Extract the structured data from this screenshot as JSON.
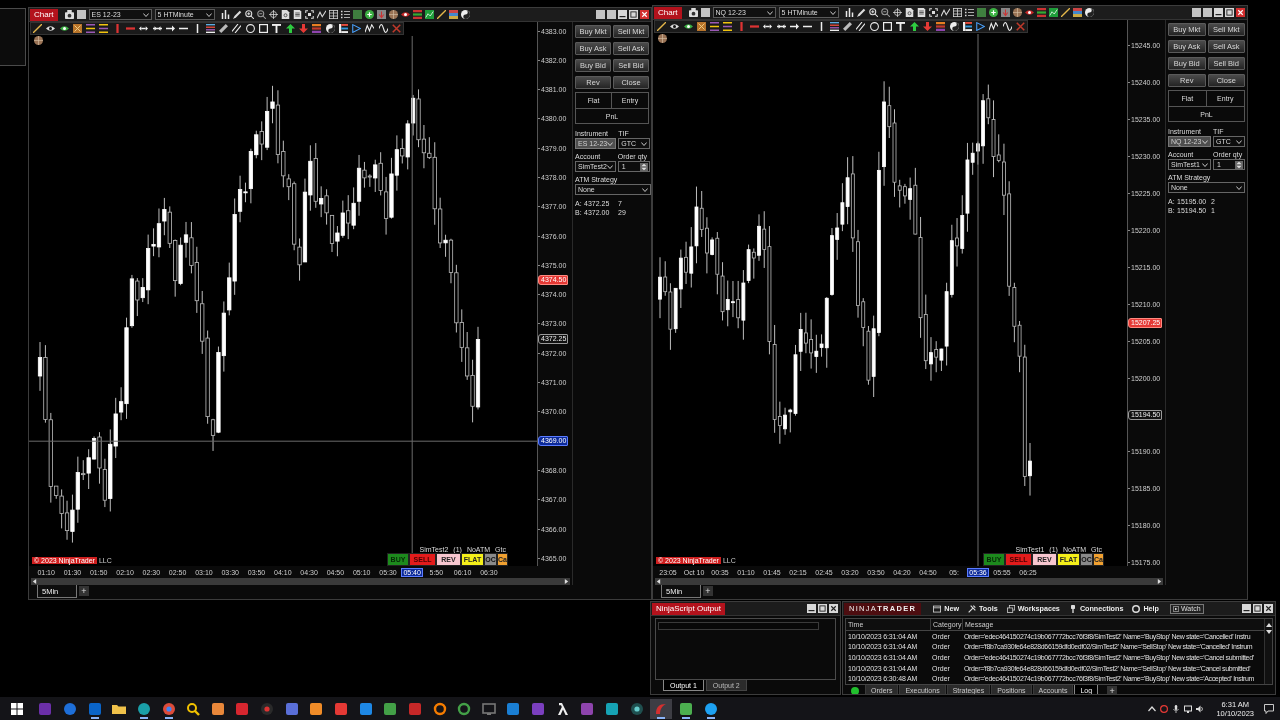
{
  "charts": [
    {
      "title": "Chart",
      "instrument": "ES 12-23",
      "interval": "5 HTMinute",
      "price_axis": [
        {
          "label": "4383.00",
          "kind": "tick"
        },
        {
          "label": "4382.00",
          "kind": "tick"
        },
        {
          "label": "4381.00",
          "kind": "tick"
        },
        {
          "label": "4380.00",
          "kind": "tick"
        },
        {
          "label": "4379.00",
          "kind": "tick"
        },
        {
          "label": "4378.00",
          "kind": "tick"
        },
        {
          "label": "4377.00",
          "kind": "tick"
        },
        {
          "label": "4376.00",
          "kind": "tick"
        },
        {
          "label": "4375.00",
          "kind": "tick"
        },
        {
          "label": "4374.50",
          "kind": "last"
        },
        {
          "label": "4374.00",
          "kind": "tick"
        },
        {
          "label": "4373.00",
          "kind": "tick"
        },
        {
          "label": "4372.25",
          "kind": "quote"
        },
        {
          "label": "4372.00",
          "kind": "tick"
        },
        {
          "label": "4371.00",
          "kind": "tick"
        },
        {
          "label": "4370.00",
          "kind": "tick"
        },
        {
          "label": "4369.00",
          "kind": "cursor"
        },
        {
          "label": "4368.00",
          "kind": "tick"
        },
        {
          "label": "4367.00",
          "kind": "tick"
        },
        {
          "label": "4366.00",
          "kind": "tick"
        },
        {
          "label": "4365.00",
          "kind": "tick"
        }
      ],
      "time_axis": [
        {
          "label": "01:10",
          "selected": false
        },
        {
          "label": "01:30",
          "selected": false
        },
        {
          "label": "01:50",
          "selected": false
        },
        {
          "label": "02:10",
          "selected": false
        },
        {
          "label": "02:30",
          "selected": false
        },
        {
          "label": "02:50",
          "selected": false
        },
        {
          "label": "03:10",
          "selected": false
        },
        {
          "label": "03:30",
          "selected": false
        },
        {
          "label": "03:50",
          "selected": false
        },
        {
          "label": "04:10",
          "selected": false
        },
        {
          "label": "04:30",
          "selected": false
        },
        {
          "label": "04:50",
          "selected": false
        },
        {
          "label": "05:10",
          "selected": false
        },
        {
          "label": "05:30",
          "selected": false
        },
        {
          "label": "05:40",
          "selected": true
        },
        {
          "label": "5:50",
          "selected": false
        },
        {
          "label": "06:10",
          "selected": false
        },
        {
          "label": "06:30",
          "selected": false
        }
      ],
      "copyright": {
        "badge": "© 2023 NinjaTrader",
        "suffix": "LLC"
      },
      "chart_trader": {
        "account": "SimTest2",
        "position": "(1)",
        "atm": "NoATM",
        "tif": "Gtc",
        "buttons": [
          {
            "label": "BUY",
            "kind": "buy"
          },
          {
            "label": "SELL",
            "kind": "sell"
          },
          {
            "label": "REV",
            "kind": "reverse"
          },
          {
            "label": "FLAT",
            "kind": "flat"
          },
          {
            "label": "OC",
            "kind": "oco"
          },
          {
            "label": "Ca",
            "kind": "cancel"
          }
        ]
      },
      "order_panel": {
        "buttons": [
          "Buy Mkt",
          "Sell Mkt",
          "Buy Ask",
          "Sell Ask",
          "Buy Bid",
          "Sell Bid",
          "Rev",
          "Close"
        ],
        "position": "Flat",
        "entry": "Entry",
        "pnl": "PnL",
        "instrument_label": "Instrument",
        "instrument": {
          "value": "ES 12-23",
          "disabled": true
        },
        "tif_label": "TIF",
        "tif": "GTC",
        "account_label": "Account",
        "account": "SimTest2",
        "qty_label": "Order qty",
        "qty": "1",
        "atm_label": "ATM Strategy",
        "atm": "None",
        "quotes": [
          {
            "label": "A:",
            "price": "4372.25",
            "size": "7"
          },
          {
            "label": "B:",
            "price": "4372.00",
            "size": "29"
          }
        ]
      },
      "tabs": [
        {
          "label": "5Min",
          "selected": true
        }
      ],
      "add_tab": "+"
    },
    {
      "title": "Chart",
      "instrument": "NQ 12-23",
      "interval": "5 HTMinute",
      "price_axis": [
        {
          "label": "15245.00",
          "kind": "tick"
        },
        {
          "label": "15240.00",
          "kind": "tick"
        },
        {
          "label": "15235.00",
          "kind": "tick"
        },
        {
          "label": "15230.00",
          "kind": "tick"
        },
        {
          "label": "15225.00",
          "kind": "tick"
        },
        {
          "label": "15220.00",
          "kind": "tick"
        },
        {
          "label": "15215.00",
          "kind": "tick"
        },
        {
          "label": "15210.00",
          "kind": "tick"
        },
        {
          "label": "15207.25",
          "kind": "last"
        },
        {
          "label": "15205.00",
          "kind": "tick"
        },
        {
          "label": "15200.00",
          "kind": "tick"
        },
        {
          "label": "15194.50",
          "kind": "marked"
        },
        {
          "label": "15190.00",
          "kind": "tick"
        },
        {
          "label": "15185.00",
          "kind": "tick"
        },
        {
          "label": "15180.00",
          "kind": "tick"
        },
        {
          "label": "15175.00",
          "kind": "tick"
        }
      ],
      "time_axis": [
        {
          "label": "23:05",
          "selected": false
        },
        {
          "label": "Oct 10",
          "selected": false
        },
        {
          "label": "00:35",
          "selected": false
        },
        {
          "label": "01:10",
          "selected": false
        },
        {
          "label": "01:45",
          "selected": false
        },
        {
          "label": "02:15",
          "selected": false
        },
        {
          "label": "02:45",
          "selected": false
        },
        {
          "label": "03:20",
          "selected": false
        },
        {
          "label": "03:50",
          "selected": false
        },
        {
          "label": "04:20",
          "selected": false
        },
        {
          "label": "04:50",
          "selected": false
        },
        {
          "label": "05:",
          "selected": false
        },
        {
          "label": "05:36",
          "selected": true
        },
        {
          "label": "05:55",
          "selected": false
        },
        {
          "label": "06:25",
          "selected": false
        }
      ],
      "copyright": {
        "badge": "© 2023 NinjaTrader",
        "suffix": "LLC"
      },
      "chart_trader": {
        "account": "SimTest1",
        "position": "(1)",
        "atm": "NoATM",
        "tif": "Gtc",
        "buttons": [
          {
            "label": "BUY",
            "kind": "buy"
          },
          {
            "label": "SELL",
            "kind": "sell"
          },
          {
            "label": "REV",
            "kind": "reverse"
          },
          {
            "label": "FLAT",
            "kind": "flat"
          },
          {
            "label": "OC",
            "kind": "oco"
          },
          {
            "label": "Ca",
            "kind": "cancel"
          }
        ]
      },
      "order_panel": {
        "buttons": [
          "Buy Mkt",
          "Sell Mkt",
          "Buy Ask",
          "Sell Ask",
          "Buy Bid",
          "Sell Bid",
          "Rev",
          "Close"
        ],
        "position": "Flat",
        "entry": "Entry",
        "pnl": "PnL",
        "instrument_label": "Instrument",
        "instrument": {
          "value": "NQ 12-23",
          "disabled": true
        },
        "tif_label": "TIF",
        "tif": "GTC",
        "account_label": "Account",
        "account": "SimTest1",
        "qty_label": "Order qty",
        "qty": "1",
        "atm_label": "ATM Strategy",
        "atm": "None",
        "quotes": [
          {
            "label": "A:",
            "price": "15195.00",
            "size": "2"
          },
          {
            "label": "B:",
            "price": "15194.50",
            "size": "1"
          }
        ]
      },
      "tabs": [
        {
          "label": "5Min",
          "selected": true
        }
      ],
      "add_tab": "+"
    }
  ],
  "ninjascript_output": {
    "title": "NinjaScript Output",
    "tabs": [
      {
        "label": "Output 1",
        "selected": true
      },
      {
        "label": "Output 2",
        "selected": false
      }
    ]
  },
  "control_center": {
    "logo": "NINJA**TRADER**",
    "menu": [
      "New",
      "Tools",
      "Workspaces",
      "Connections",
      "Help"
    ],
    "watch": "Watch",
    "table": {
      "columns": [
        "Time",
        "Category",
        "Message"
      ],
      "rows": [
        [
          "10/10/2023 6:31:04 AM",
          "Order",
          "Order='edec464150274c19b067772bcc76f3f8/SimTest2' Name='BuyStop' New state='Cancelled' Instru"
        ],
        [
          "10/10/2023 6:31:04 AM",
          "Order",
          "Order='f8b7ca930fe64e828d66159dfd0edf02/SimTest2' Name='SellStop' New state='Cancelled' Instrum"
        ],
        [
          "10/10/2023 6:31:04 AM",
          "Order",
          "Order='edec464150274c19b067772bcc76f3f8/SimTest2' Name='BuyStop' New state='Cancel submitted'"
        ],
        [
          "10/10/2023 6:31:04 AM",
          "Order",
          "Order='f8b7ca930fe64e828d66159dfd0edf02/SimTest2' Name='SellStop' New state='Cancel submitted'"
        ],
        [
          "10/10/2023 6:30:48 AM",
          "Order",
          "Order='edec464150274c19b067772bcc76f3f8/SimTest2' Name='BuyStop' New state='Accepted' Instrum"
        ]
      ]
    },
    "connected": true,
    "tabs": [
      {
        "label": "Orders",
        "selected": false
      },
      {
        "label": "Executions",
        "selected": false
      },
      {
        "label": "Strategies",
        "selected": false
      },
      {
        "label": "Positions",
        "selected": false
      },
      {
        "label": "Accounts",
        "selected": false
      },
      {
        "label": "Log",
        "selected": true
      }
    ],
    "add_tab": "+"
  },
  "taskbar": {
    "apps": [
      {
        "running": false,
        "selected": false
      },
      {
        "running": false,
        "selected": false
      },
      {
        "running": true,
        "selected": false
      },
      {
        "running": false,
        "selected": false
      },
      {
        "running": true,
        "selected": false
      },
      {
        "running": true,
        "selected": false
      },
      {
        "running": false,
        "selected": false
      },
      {
        "running": false,
        "selected": false
      },
      {
        "running": false,
        "selected": false
      },
      {
        "running": false,
        "selected": false
      },
      {
        "running": false,
        "selected": false
      },
      {
        "running": false,
        "selected": false
      },
      {
        "running": false,
        "selected": false
      },
      {
        "running": false,
        "selected": false
      },
      {
        "running": false,
        "selected": false
      },
      {
        "running": false,
        "selected": false
      },
      {
        "running": false,
        "selected": false
      },
      {
        "running": false,
        "selected": false
      },
      {
        "running": false,
        "selected": false
      },
      {
        "running": false,
        "selected": false
      },
      {
        "running": false,
        "selected": false
      },
      {
        "running": false,
        "selected": false
      },
      {
        "running": false,
        "selected": false
      },
      {
        "running": false,
        "selected": false
      },
      {
        "running": false,
        "selected": false
      },
      {
        "running": true,
        "selected": true
      },
      {
        "running": true,
        "selected": false
      },
      {
        "running": true,
        "selected": false
      }
    ],
    "time": "6:31 AM",
    "date": "10/10/2023"
  }
}
